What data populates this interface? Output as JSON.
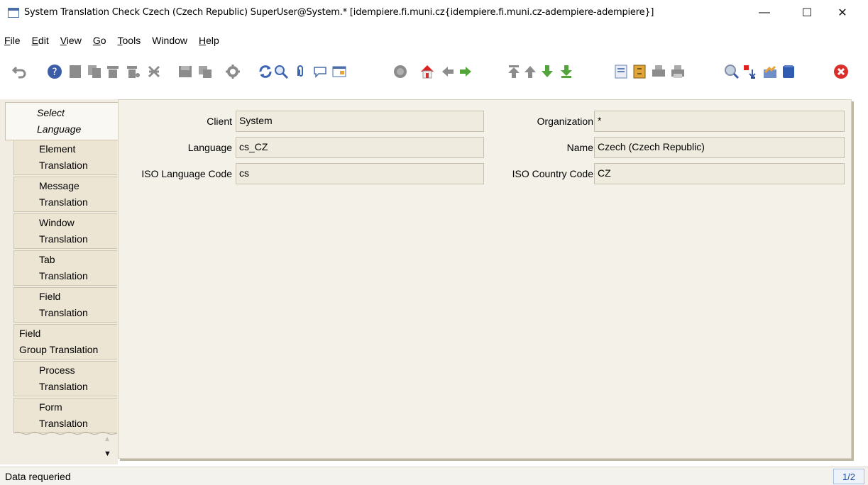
{
  "window": {
    "title": "System Translation Check  Czech (Czech Republic)  SuperUser@System.* [idempiere.fi.muni.cz{idempiere.fi.muni.cz-adempiere-adempiere}]",
    "minimize": "—",
    "maximize": "☐",
    "close": "✕"
  },
  "menu": {
    "file": {
      "ul": "F",
      "rest": "ile"
    },
    "edit": {
      "ul": "E",
      "rest": "dit"
    },
    "view": {
      "ul": "V",
      "rest": "iew"
    },
    "go": {
      "ul": "G",
      "rest": "o"
    },
    "tools": {
      "ul": "T",
      "rest": "ools"
    },
    "window": {
      "ul": "",
      "rest": "Window"
    },
    "help": {
      "ul": "H",
      "rest": "elp"
    }
  },
  "tabs": [
    {
      "line1": "Select",
      "line2": "Language"
    },
    {
      "line1": "Element",
      "line2": "Translation"
    },
    {
      "line1": "Message",
      "line2": "Translation"
    },
    {
      "line1": "Window",
      "line2": "Translation"
    },
    {
      "line1": "Tab",
      "line2": "Translation"
    },
    {
      "line1": "Field",
      "line2": "Translation"
    },
    {
      "line1": "Field",
      "line2": "Group Translation"
    },
    {
      "line1": "Process",
      "line2": "Translation"
    },
    {
      "line1": "Form",
      "line2": "Translation"
    }
  ],
  "fields": {
    "client": {
      "label": "Client",
      "value": "System"
    },
    "organization": {
      "label": "Organization",
      "value": "*"
    },
    "language": {
      "label": "Language",
      "value": "cs_CZ"
    },
    "name": {
      "label": "Name",
      "value": "Czech (Czech Republic)"
    },
    "iso_language": {
      "label": "ISO Language Code",
      "value": "cs"
    },
    "iso_country": {
      "label": "ISO Country Code",
      "value": "CZ"
    }
  },
  "status": {
    "message": "Data requeried",
    "record": "1/2"
  },
  "toolbar_icons": [
    "undo-icon",
    "help-icon",
    "new-record-icon",
    "copy-record-icon",
    "delete-icon",
    "delete-selection-icon",
    "save-icon",
    "save-new-icon",
    "customize-icon",
    "refresh-icon",
    "find-icon",
    "attachment-icon",
    "chat-icon",
    "grid-toggle-icon",
    "history-icon",
    "home-icon",
    "previous-tab-icon",
    "next-tab-icon",
    "first-record-icon",
    "previous-record-icon",
    "next-record-icon",
    "last-record-icon",
    "report-icon",
    "archive-icon",
    "print-preview-icon",
    "print-icon",
    "zoom-across-icon",
    "request-icon",
    "product-info-icon",
    "window-icon",
    "end-icon"
  ]
}
